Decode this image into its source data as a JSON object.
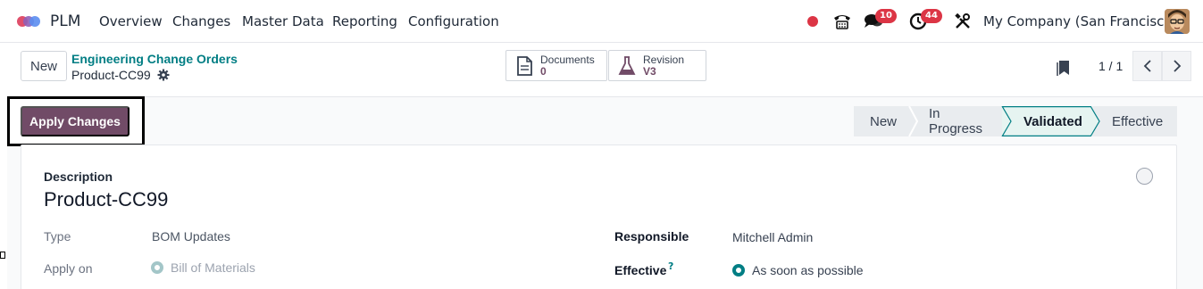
{
  "nav": {
    "app_name": "PLM",
    "menu": [
      "Overview",
      "Changes",
      "Master Data",
      "Reporting",
      "Configuration"
    ],
    "messages_badge": "10",
    "activities_badge": "44",
    "company": "My Company (San Francisco)"
  },
  "control_panel": {
    "new_label": "New",
    "breadcrumb_parent": "Engineering Change Orders",
    "breadcrumb_current": "Product-CC99",
    "stat_buttons": [
      {
        "label": "Documents",
        "value": "0"
      },
      {
        "label": "Revision",
        "value": "V3"
      }
    ],
    "pager": "1 / 1"
  },
  "header": {
    "apply_label": "Apply Changes",
    "stages": [
      "New",
      "In Progress",
      "Validated",
      "Effective"
    ],
    "active_stage": "Validated"
  },
  "form": {
    "description_label": "Description",
    "description_value": "Product-CC99",
    "type_label": "Type",
    "type_value": "BOM Updates",
    "apply_on_label": "Apply on",
    "apply_on_value": "Bill of Materials",
    "responsible_label": "Responsible",
    "responsible_value": "Mitchell Admin",
    "effective_label": "Effective",
    "effective_help": "?",
    "effective_value": "As soon as possible"
  },
  "colors": {
    "brand": "#714b67",
    "link": "#017e84",
    "badge": "#dc3545"
  }
}
